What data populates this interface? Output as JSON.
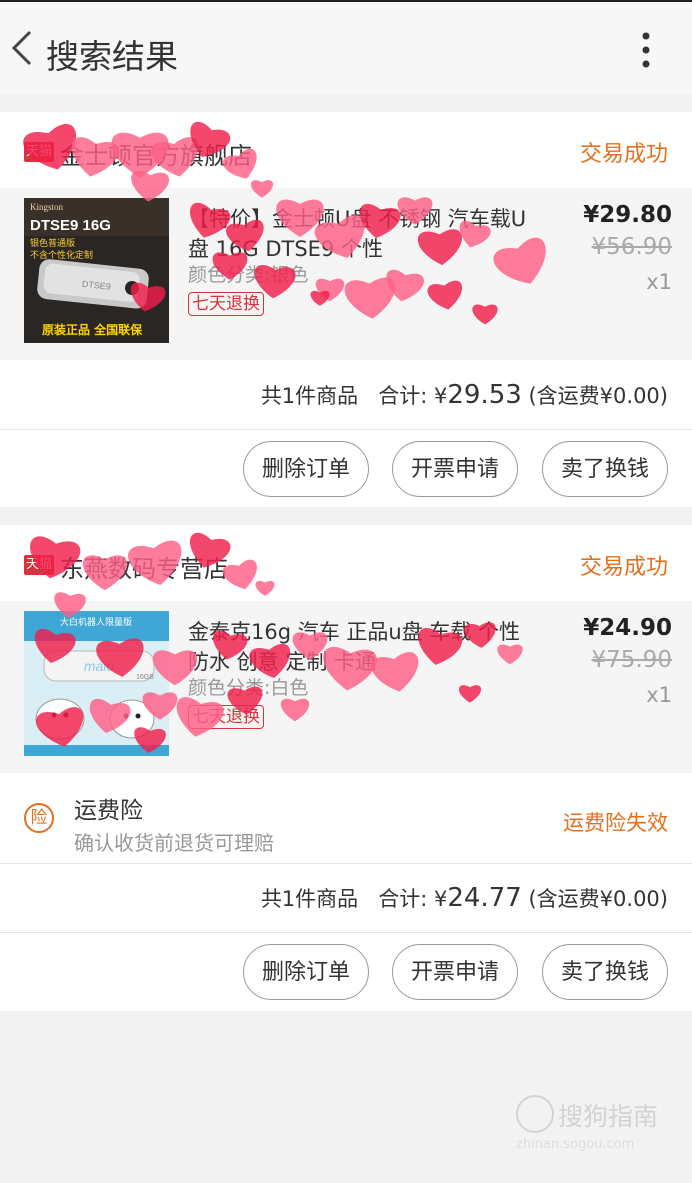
{
  "header": {
    "title": "搜索结果"
  },
  "orders": [
    {
      "shop_badge": "天猫",
      "shop_name": "金士顿官方旗舰店",
      "status": "交易成功",
      "item": {
        "title": "【特价】金士顿U盘 不锈钢 汽车载U盘 16G DTSE9 个性",
        "sku": "颜色分类:银色",
        "tag": "七天退换",
        "price": "¥29.80",
        "original_price": "¥56.90",
        "qty": "x1",
        "thumb": {
          "brand": "Kingston",
          "model": "DTSE9 16G",
          "line1": "银色普通版",
          "line2": "不含个性化定制",
          "bottom": "原装正品 全国联保",
          "engraving": "DTSE9"
        }
      },
      "summary": {
        "items": "共1件商品",
        "label": "合计:",
        "currency": "¥",
        "amount": "29.53",
        "shipping": "(含运费¥0.00)"
      },
      "buttons": {
        "delete": "删除订单",
        "invoice": "开票申请",
        "sell": "卖了换钱"
      }
    },
    {
      "shop_badge": "天猫",
      "shop_name": "东燕数码专营店",
      "status": "交易成功",
      "item": {
        "title": "金泰克16g 汽车 正品u盘 车载 个性 防水 创意 定制 卡通",
        "sku": "颜色分类:白色",
        "tag": "七天退换",
        "price": "¥24.90",
        "original_price": "¥75.90",
        "qty": "x1",
        "thumb": {
          "banner": "大白机器人限量版",
          "brand": "maio",
          "size": "16GB"
        }
      },
      "insurance": {
        "icon_text": "险",
        "title": "运费险",
        "desc": "确认收货前退货可理赔",
        "status": "运费险失效"
      },
      "summary": {
        "items": "共1件商品",
        "label": "合计:",
        "currency": "¥",
        "amount": "24.77",
        "shipping": "(含运费¥0.00)"
      },
      "buttons": {
        "delete": "删除订单",
        "invoice": "开票申请",
        "sell": "卖了换钱"
      }
    }
  ],
  "watermark": {
    "text": "搜狗指南",
    "sub": "zhinan.sogou.com"
  },
  "colors": {
    "accent": "#e4701e",
    "tmall": "#d6333a",
    "sticker_pink": "#ff5f87",
    "sticker_red": "#f01f4a"
  },
  "icons": {
    "back": "chevron-left-icon",
    "more": "more-vertical-icon",
    "insurance": "insurance-badge-icon"
  }
}
